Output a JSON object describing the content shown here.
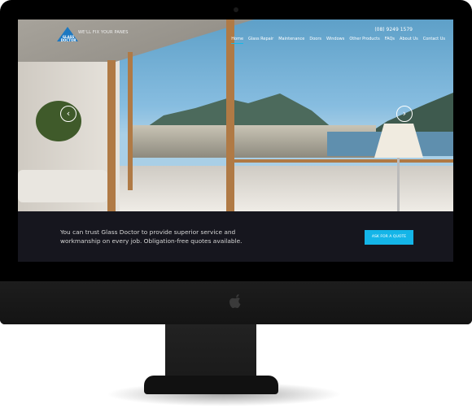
{
  "site": {
    "logo_text": "GLASS DOCTOR",
    "tagline": "WE'LL FIX YOUR PANES",
    "phone": "(08) 9249 1579",
    "nav": [
      {
        "label": "Home",
        "active": true
      },
      {
        "label": "Glass Repair"
      },
      {
        "label": "Maintenance"
      },
      {
        "label": "Doors"
      },
      {
        "label": "Windows"
      },
      {
        "label": "Other Products"
      },
      {
        "label": "FAQs"
      },
      {
        "label": "About Us"
      },
      {
        "label": "Contact Us"
      }
    ],
    "slider": {
      "prev": "‹",
      "next": "›"
    },
    "band": {
      "text": "You can trust Glass Doctor to provide superior service and workmanship on every job. Obligation-free quotes available.",
      "cta": "ASK FOR A QUOTE"
    }
  },
  "colors": {
    "accent": "#14b5e8",
    "band": "#16161e",
    "logo": "#1d78c1"
  }
}
